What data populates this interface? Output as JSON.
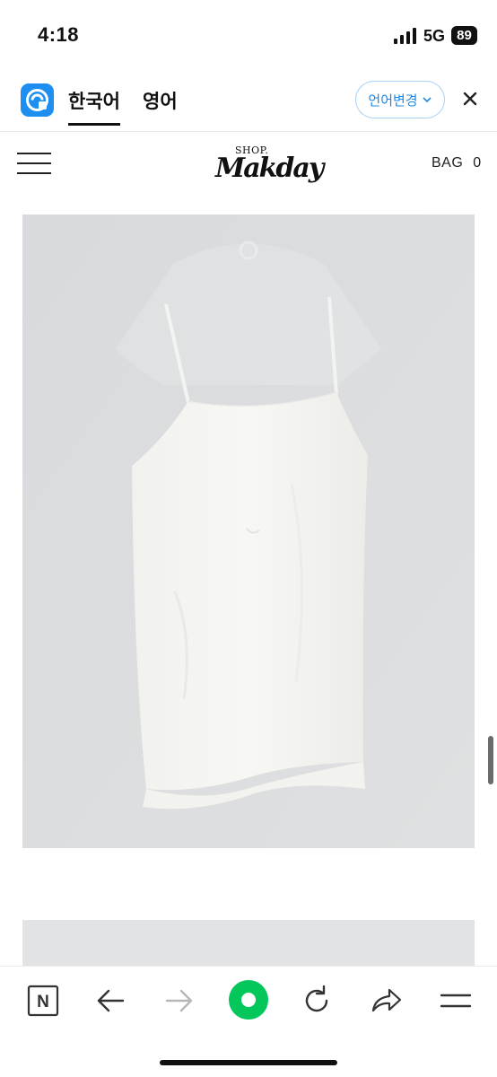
{
  "status_bar": {
    "time": "4:18",
    "network": "5G",
    "battery": "89",
    "signal_icon": "signal-bars-icon"
  },
  "translate_bar": {
    "logo_icon": "papago-translate-icon",
    "tabs": [
      {
        "label": "한국어",
        "active": true
      },
      {
        "label": "영어",
        "active": false
      }
    ],
    "change_language_label": "언어변경",
    "change_icon": "chevron-down-icon",
    "close_icon": "close-icon",
    "accent_color": "#1e88e5"
  },
  "shop_header": {
    "menu_icon": "hamburger-menu-icon",
    "brand_top": "SHOP.",
    "brand_main": "Makday",
    "bag_label": "BAG",
    "bag_count": "0"
  },
  "product": {
    "images": [
      {
        "description_icon": "product-image-white-slip-dress"
      },
      {
        "description_icon": "product-image-partial"
      }
    ]
  },
  "bottom_toolbar": {
    "buttons": [
      {
        "icon": "naver-home-icon",
        "label": "N"
      },
      {
        "icon": "back-arrow-icon"
      },
      {
        "icon": "forward-arrow-icon"
      },
      {
        "icon": "green-dot-icon"
      },
      {
        "icon": "refresh-icon"
      },
      {
        "icon": "share-icon"
      },
      {
        "icon": "menu-icon"
      }
    ],
    "accent_color": "#03c75a"
  }
}
